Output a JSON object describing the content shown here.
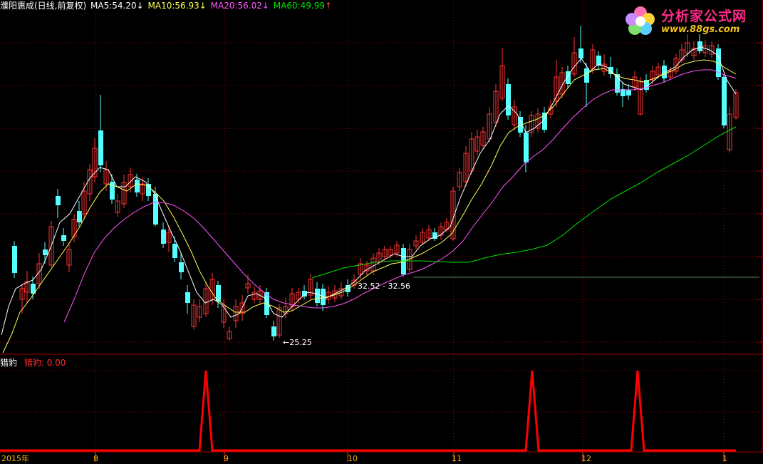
{
  "header": {
    "stock_name": "濮阳惠成(日线,前复权)",
    "ma5_label": "MA5:",
    "ma5_value": "54.20",
    "ma5_arrow": "↓",
    "ma10_label": "MA10:",
    "ma10_value": "56.93",
    "ma10_arrow": "↓",
    "ma20_label": "MA20:",
    "ma20_value": "56.02",
    "ma20_arrow": "↓",
    "ma60_label": "MA60:",
    "ma60_value": "49.99",
    "ma60_arrow": "↑"
  },
  "indicator": {
    "name": "猎豹",
    "value_label": "猎豹: 0.00"
  },
  "annotations": {
    "low_price": "25.25",
    "gap_range": "32.52 - 32.56"
  },
  "x_axis": {
    "labels": [
      "2015年",
      "8",
      "9",
      "10",
      "11",
      "12",
      "1"
    ]
  },
  "watermark": {
    "title": "分析家公式网",
    "url": "www.88gs.com"
  },
  "colors": {
    "background": "#000000",
    "up_candle": "#ff3232",
    "down_candle": "#54ffff",
    "ma5": "#ffffff",
    "ma10": "#ffff54",
    "ma20": "#ff54ff",
    "ma60": "#00e600",
    "grid": "#a00000",
    "indicator_line": "#ff0000"
  },
  "chart_data": {
    "type": "candlestick",
    "title": "濮阳惠成(日线,前复权)",
    "moving_averages": {
      "MA5": 54.2,
      "MA10": 56.93,
      "MA20": 56.02,
      "MA60": 49.99
    },
    "period_labels": [
      "2015年",
      "8",
      "9",
      "10",
      "11",
      "12",
      "1"
    ],
    "visible_low": 25.25,
    "gap_annotation": "32.52 - 32.56",
    "indicator": {
      "name": "猎豹",
      "current_value": 0.0,
      "signal_spikes": 3
    }
  }
}
